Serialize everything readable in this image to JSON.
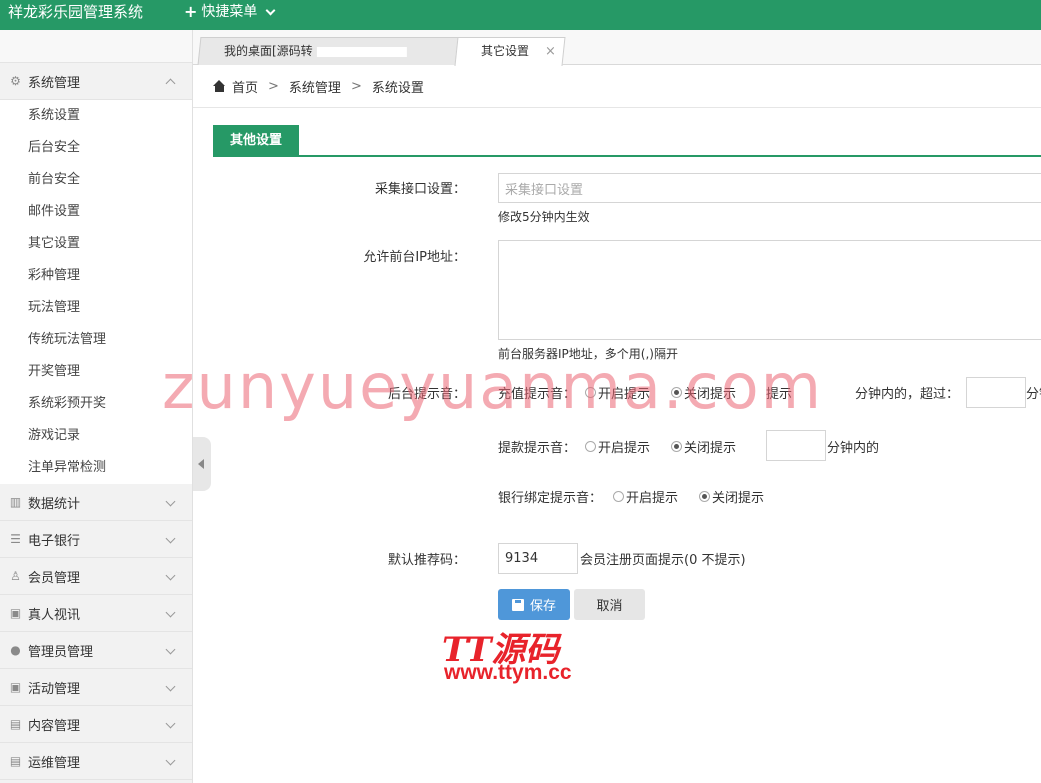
{
  "app": {
    "title": "祥龙彩乐园管理系统",
    "quick_menu": "快捷菜单"
  },
  "tabs": [
    {
      "label": "我的桌面[源码转"
    },
    {
      "label": "其它设置",
      "close": "×"
    }
  ],
  "breadcrumb": {
    "home": "首页",
    "sep": ">",
    "level1": "系统管理",
    "level2": "系统设置"
  },
  "sidebar": {
    "system": {
      "label": "系统管理",
      "items": [
        "系统设置",
        "后台安全",
        "前台安全",
        "邮件设置",
        "其它设置",
        "彩种管理",
        "玩法管理",
        "传统玩法管理",
        "开奖管理",
        "系统彩预开奖",
        "游戏记录",
        "注单异常检测"
      ]
    },
    "groups": [
      "数据统计",
      "电子银行",
      "会员管理",
      "真人视讯",
      "管理员管理",
      "活动管理",
      "内容管理",
      "运维管理"
    ]
  },
  "section": {
    "title": "其他设置"
  },
  "form": {
    "collect": {
      "label": "采集接口设置：",
      "placeholder": "采集接口设置",
      "help": "修改5分钟内生效"
    },
    "ip": {
      "label": "允许前台IP地址：",
      "help": "前台服务器IP地址，多个用(,)隔开"
    },
    "sound": {
      "label": "后台提示音：",
      "recharge": {
        "label": "充值提示音：",
        "on": "开启提示",
        "off": "关闭提示",
        "hint": "提示",
        "minutes_within": "分钟内的，超过：",
        "unit": "分钟"
      },
      "withdraw": {
        "label": "提款提示音：",
        "on": "开启提示",
        "off": "关闭提示",
        "minutes_within": "分钟内的"
      },
      "bank": {
        "label": "银行绑定提示音：",
        "on": "开启提示",
        "off": "关闭提示"
      }
    },
    "referral": {
      "label": "默认推荐码：",
      "value": "9134",
      "help": "会员注册页面提示(0 不提示)"
    },
    "save": "保存",
    "cancel": "取消"
  },
  "watermark": "zunyueyuanma.com",
  "logo": {
    "line1": "TT源码",
    "line2": "www.ttym.cc"
  },
  "colors": {
    "brand": "#269966",
    "primary_button": "#4f97d9"
  }
}
